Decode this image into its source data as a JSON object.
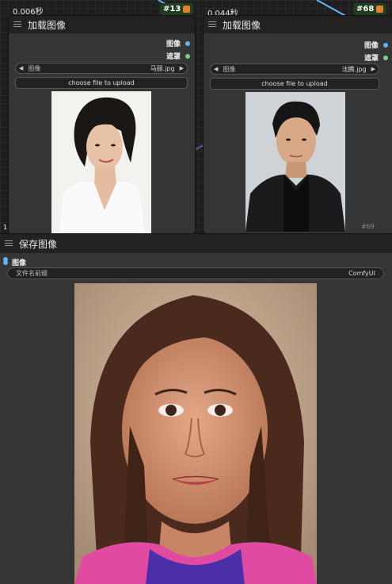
{
  "timings": {
    "left": "0.006秒",
    "right": "0.044秒"
  },
  "node_ids": {
    "left": "#13",
    "right": "#68",
    "bottom_right_overlay": "#69",
    "bottom_left_overlay": "1"
  },
  "load_image_left": {
    "title": "加载图像",
    "outputs": [
      {
        "label": "图像",
        "color": "#64b5f6"
      },
      {
        "label": "遮罩",
        "color": "#7ccf7c"
      }
    ],
    "combo": {
      "label": "图像",
      "value": "马丽.jpg"
    },
    "upload_button": "choose file to upload",
    "preview_alt": "woman-portrait-photo"
  },
  "load_image_right": {
    "title": "加载图像",
    "outputs": [
      {
        "label": "图像",
        "color": "#64b5f6"
      },
      {
        "label": "遮罩",
        "color": "#7ccf7c"
      }
    ],
    "combo": {
      "label": "图像",
      "value": "沈腾.jpg"
    },
    "upload_button": "choose file to upload",
    "preview_alt": "man-portrait-photo"
  },
  "save_image": {
    "title": "保存图像",
    "input": {
      "label": "图像",
      "color": "#64b5f6"
    },
    "filename_prefix": {
      "label": "文件名前缀",
      "value": "ComfyUI"
    },
    "output_preview": "generated-girl-portrait"
  },
  "colors": {
    "accent_wire": "#64b5f6",
    "node_bg": "#353535",
    "header_bg": "#222222",
    "id_badge": "#1f3d1f"
  }
}
